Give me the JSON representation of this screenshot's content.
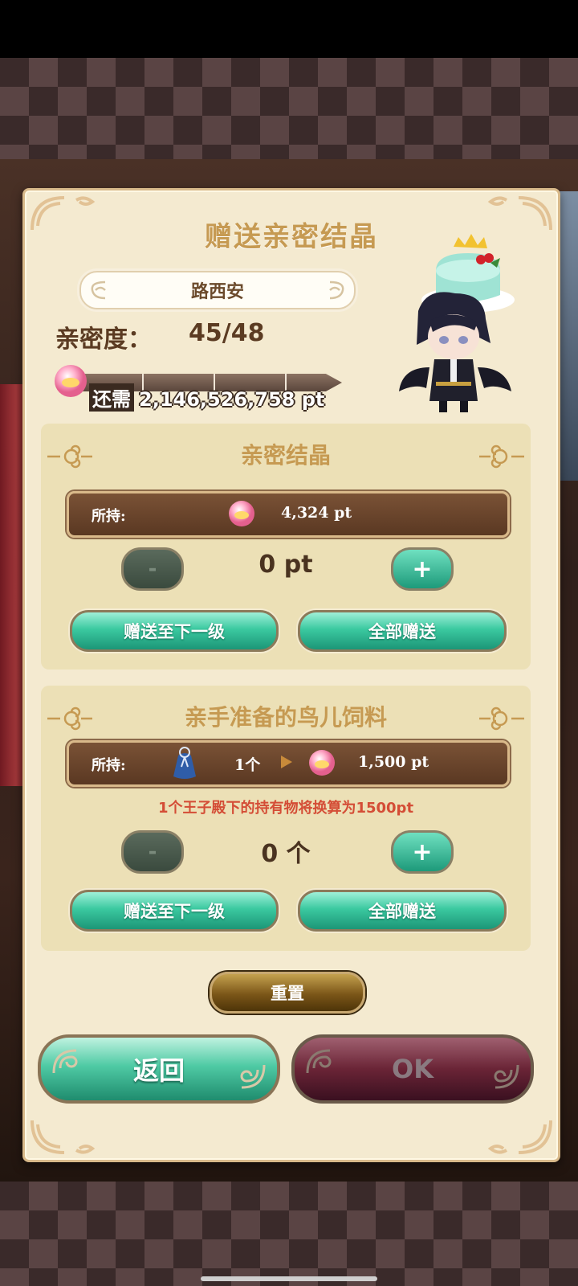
{
  "title": "赠送亲密结晶",
  "character_name": "路西安",
  "intimacy": {
    "label": "亲密度：",
    "value": "45/48"
  },
  "remaining": {
    "label": "还需",
    "value": "2,146,526,758 pt"
  },
  "sections": [
    {
      "title": "亲密结晶",
      "hold_label": "所持:",
      "hold_value": "4,324 pt",
      "amount": "0 pt",
      "minus": "-",
      "plus": "+",
      "btn_next": "赠送至下一级",
      "btn_all": "全部赠送"
    },
    {
      "title": "亲手准备的鸟儿饲料",
      "hold_label": "所持:",
      "hold_count": "1个",
      "hold_value": "1,500 pt",
      "note": "1个王子殿下的持有物将换算为1500pt",
      "amount": "0 个",
      "minus": "-",
      "plus": "+",
      "btn_next": "赠送至下一级",
      "btn_all": "全部赠送"
    }
  ],
  "reset": "重置",
  "back": "返回",
  "ok": "OK",
  "colors": {
    "panel": "#f4ead0",
    "title_gold": "#c69a52",
    "green_button": "#3bc9a0",
    "note_red": "#d44d36"
  }
}
